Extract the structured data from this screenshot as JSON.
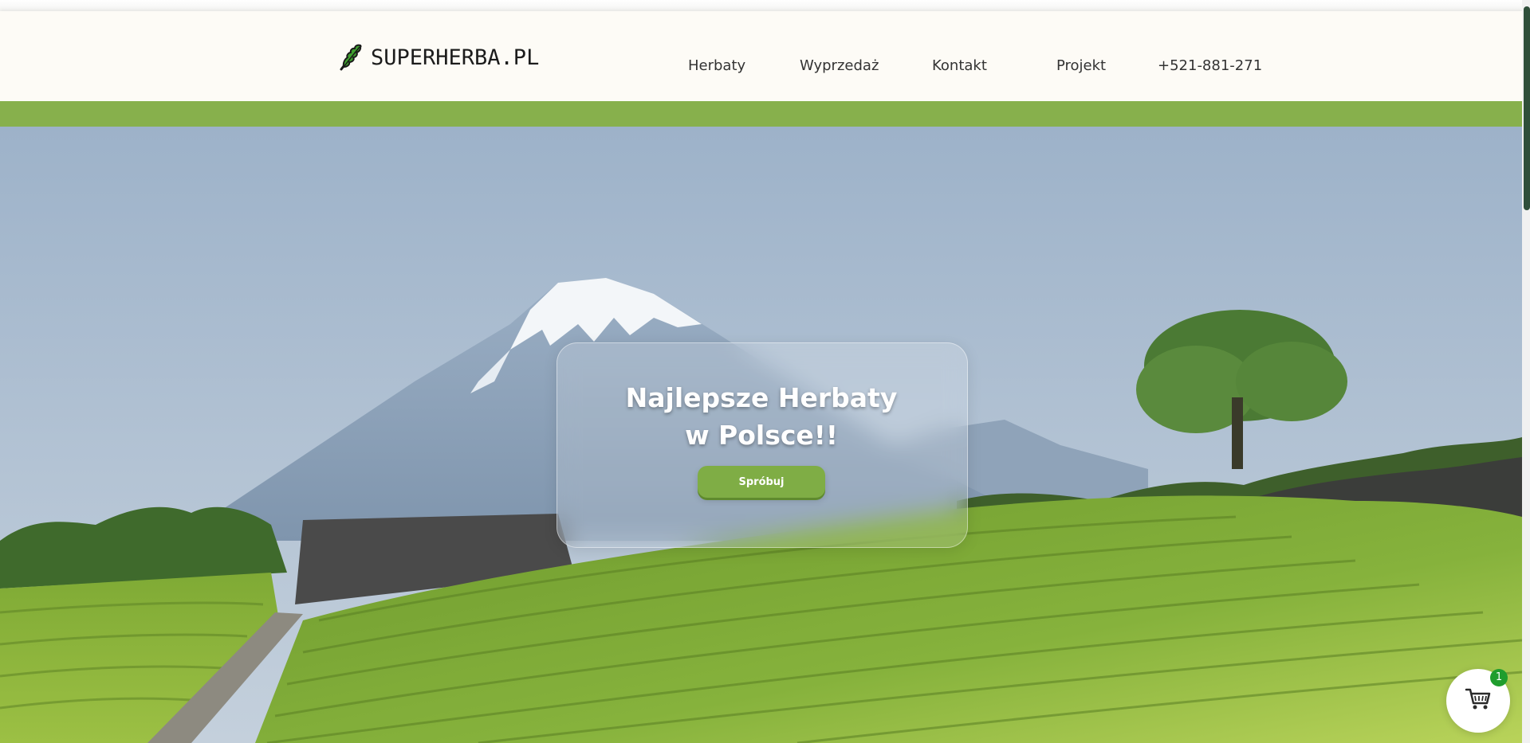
{
  "header": {
    "logo_text": "SUPERHERBA.PL",
    "logo_icon": "leaf-icon",
    "nav": {
      "herbaty": "Herbaty",
      "wyprzedaz": "Wyprzedaż",
      "kontakt": "Kontakt",
      "projekt": "Projekt",
      "phone": "+521-881-271"
    }
  },
  "hero": {
    "title_line1": "Najlepsze Herbaty",
    "title_line2": "w Polsce!!",
    "cta_label": "Spróbuj"
  },
  "cart": {
    "icon": "cart-icon",
    "count": "1"
  },
  "colors": {
    "accent_green": "#87b04c",
    "button_green": "#7fad45",
    "badge_green": "#1f9d2d",
    "header_bg": "#fdfbf6"
  }
}
